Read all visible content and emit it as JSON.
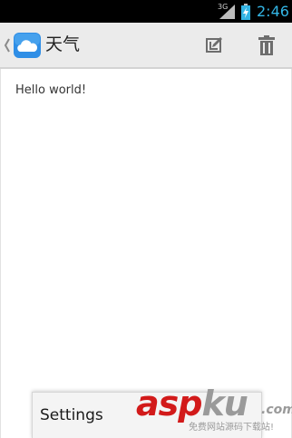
{
  "status_bar": {
    "network": "3G",
    "time": "2:46",
    "icons": [
      "signal-icon",
      "battery-charging-icon"
    ]
  },
  "action_bar": {
    "app_icon": "cloud-icon",
    "title": "天气",
    "actions": [
      {
        "icon": "edit-icon"
      },
      {
        "icon": "trash-icon"
      }
    ]
  },
  "content": {
    "text": "Hello world!"
  },
  "menu": {
    "items": [
      {
        "label": "Settings"
      }
    ]
  },
  "watermark": {
    "asp": "asp",
    "ku": "ku",
    "com": ".com",
    "sub": "免费网站源码下载站!"
  },
  "colors": {
    "status_bar_bg": "#000000",
    "clock": "#33b5e5",
    "action_bar_bg": "#ebebeb",
    "icon_gray": "#6d6d6d",
    "app_icon_blue": "#2f8ee6",
    "watermark_red": "#d21a1a"
  }
}
